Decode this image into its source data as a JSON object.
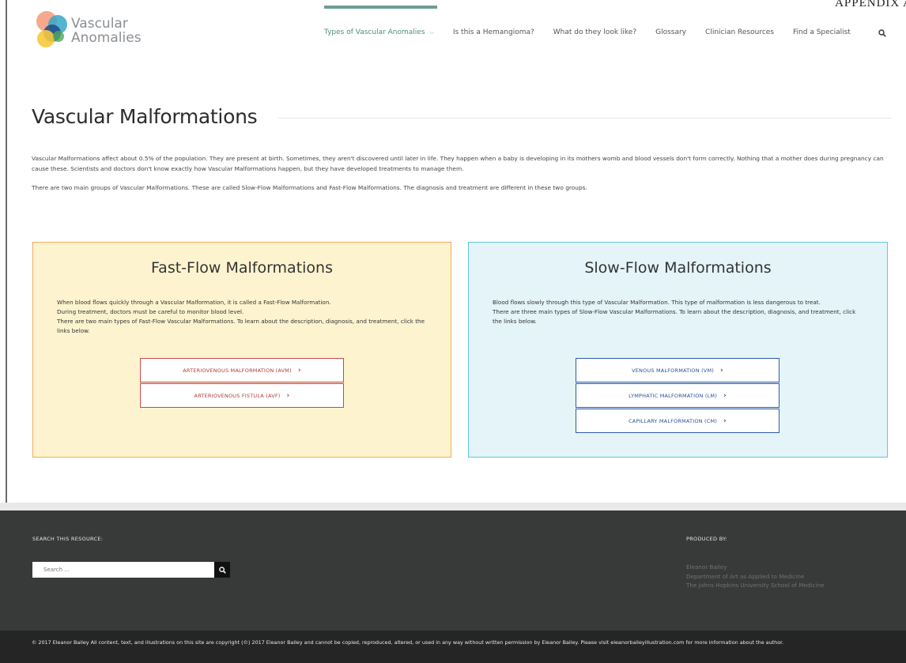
{
  "appendix": "APPENDIX A",
  "logo": {
    "line1": "Vascular",
    "line2": "Anomalies"
  },
  "nav": {
    "items": [
      {
        "label": "Types of Vascular Anomalies",
        "active": true,
        "has_dropdown": true
      },
      {
        "label": "Is this a Hemangioma?"
      },
      {
        "label": "What do they look like?"
      },
      {
        "label": "Glossary"
      },
      {
        "label": "Clinician Resources"
      },
      {
        "label": "Find a Specialist"
      }
    ],
    "search_icon": "search-icon"
  },
  "page": {
    "title": "Vascular Malformations",
    "intro_1": "Vascular Malformations affect about 0.5% of the population. They are present at birth. Sometimes, they aren't discovered until later in life. They happen when a baby is developing in its mothers womb and blood vessels don't form correctly. Nothing that a mother does during pregnancy can cause these. Scientists and doctors don't know exactly how Vascular Malformations happen, but they have developed treatments to manage them.",
    "intro_2": "There are two main groups of Vascular Malformations. These are called Slow-Flow Malformations and Fast-Flow Malformations. The diagnosis and treatment are different in these two groups."
  },
  "fast_flow": {
    "title": "Fast-Flow Malformations",
    "body_1": "When blood flows quickly through a Vascular Malformation, it is called a Fast-Flow Malformation.",
    "body_2": "During treatment, doctors must be careful to monitor blood level.",
    "body_3": "There are two main types of Fast-Flow Vascular Malformations. To learn about the description, diagnosis, and treatment,  click the links below.",
    "links": [
      {
        "label": "ARTERIOVENOUS MALFORMATION (AVM)"
      },
      {
        "label": "ARTERIOVENOUS FISTULA (AVF)"
      }
    ]
  },
  "slow_flow": {
    "title": "Slow-Flow Malformations",
    "body_1": "Blood flows slowly through this type of Vascular Malformation. This type of malformation is less dangerous to treat.",
    "body_2": "There are three main types of Slow-Flow Vascular Malformations. To learn about the description, diagnosis, and treatment,  click the links below.",
    "links": [
      {
        "label": "VENOUS MALFORMATION (VM)"
      },
      {
        "label": "LYMPHATIC MALFORMATION (LM)"
      },
      {
        "label": "CAPILLARY MALFORMATION (CM)"
      }
    ]
  },
  "footer": {
    "search_heading": "SEARCH THIS RESOURCE:",
    "search_placeholder": "Search ...",
    "produced_heading": "PRODUCED BY:",
    "produced_line_1": "Eleanor Bailey",
    "produced_line_2": "Department of Art as Applied to Medicine",
    "produced_line_3": "The Johns Hopkins University School of Medicine",
    "copyright": "© 2017 Eleanor Bailey All content, text, and illustrations on this site are copyright (©) 2017 Eleanor Bailey and cannot be copied, reproduced, altered, or used in any way without written permission by Eleanor Bailey. Please visit eleanorbaileyillustration.com for more information about the author."
  },
  "colors": {
    "accent": "#4d8f85",
    "fast_bg": "#fdf4cf",
    "fast_border": "#f3a95a",
    "fast_link": "#b23a3a",
    "slow_bg": "#e4f4f8",
    "slow_border": "#5ccbd9",
    "slow_link": "#2a4f96",
    "footer_bg": "#383a39"
  }
}
